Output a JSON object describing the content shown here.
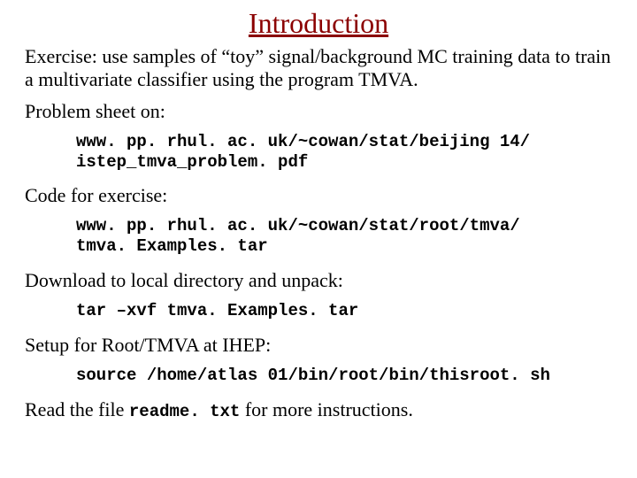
{
  "title": "Introduction",
  "intro": "Exercise:  use samples of “toy” signal/background MC training data to train a multivariate classifier using the program TMVA.",
  "problem_label": "Problem sheet on:",
  "problem_url": "www. pp. rhul. ac. uk/~cowan/stat/beijing 14/\nistep_tmva_problem. pdf",
  "code_label": "Code for exercise:",
  "code_url": "www. pp. rhul. ac. uk/~cowan/stat/root/tmva/\ntmva. Examples. tar",
  "download_label": "Download to local directory and unpack:",
  "tar_cmd": "tar –xvf tmva. Examples. tar",
  "setup_label": "Setup for Root/TMVA at IHEP:",
  "setup_cmd": "source /home/atlas 01/bin/root/bin/thisroot. sh",
  "read_prefix": "Read the file ",
  "read_file": "readme. txt",
  "read_suffix": " for more instructions."
}
